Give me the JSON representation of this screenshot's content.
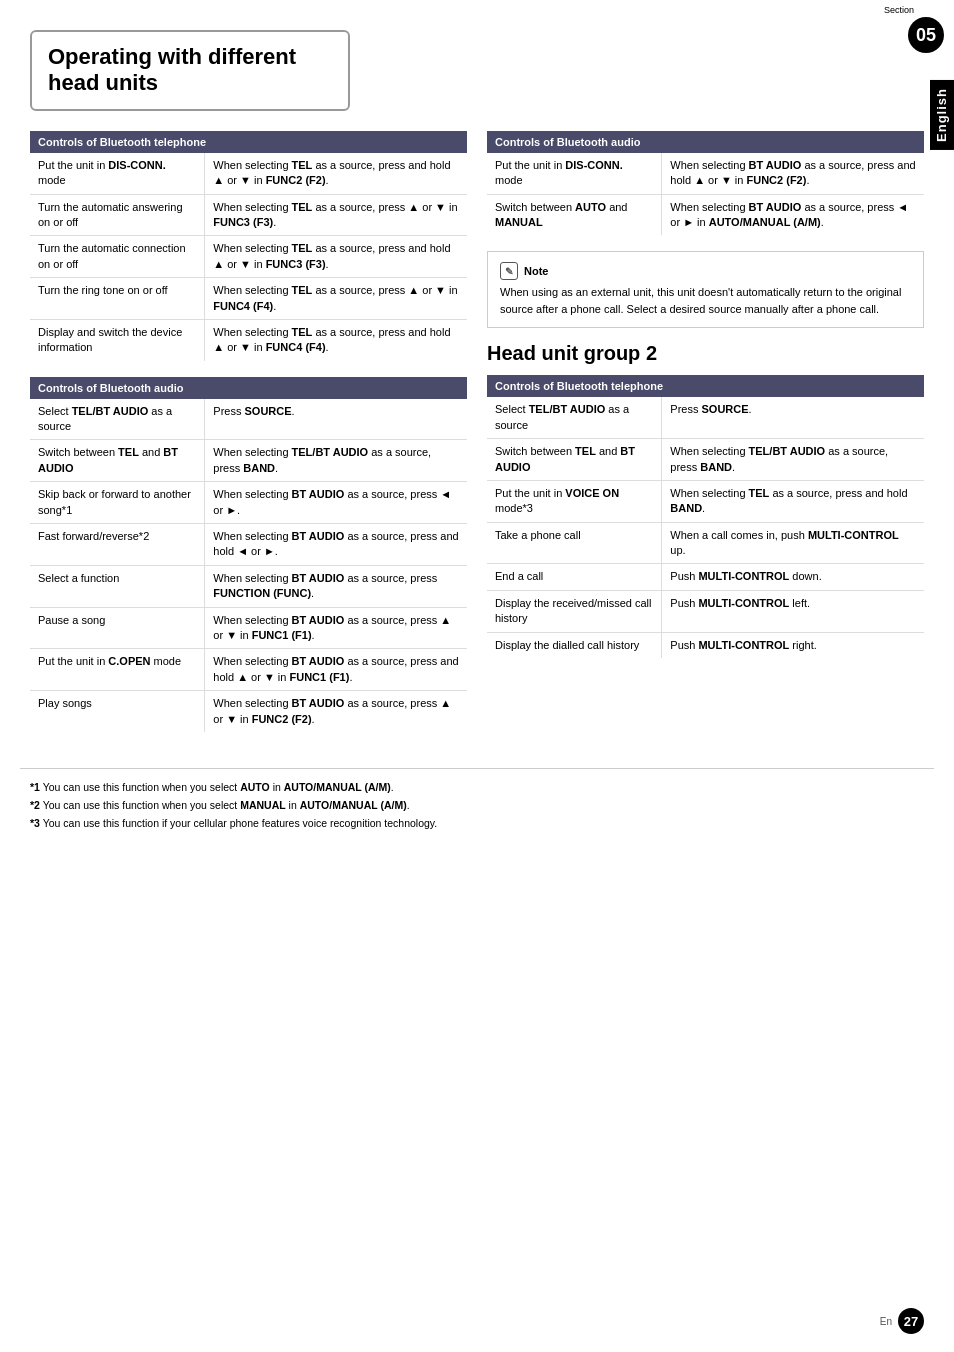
{
  "page": {
    "title": "Operating with different head units",
    "section_label": "Section",
    "section_number": "05",
    "language_label": "English",
    "page_en": "En",
    "page_number": "27"
  },
  "left_col": {
    "bt_telephone_table": {
      "header": "Controls of Bluetooth telephone",
      "rows": [
        {
          "action": "Put the unit in DIS-CONN. mode",
          "description": "When selecting TEL as a source, press and hold ▲ or ▼ in FUNC2 (F2)."
        },
        {
          "action": "Turn the automatic answering on or off",
          "description": "When selecting TEL as a source, press ▲ or ▼ in FUNC3 (F3)."
        },
        {
          "action": "Turn the automatic connection on or off",
          "description": "When selecting TEL as a source, press and hold ▲ or ▼ in FUNC3 (F3)."
        },
        {
          "action": "Turn the ring tone on or off",
          "description": "When selecting TEL as a source, press ▲ or ▼ in FUNC4 (F4)."
        },
        {
          "action": "Display and switch the device information",
          "description": "When selecting TEL as a source, press and hold ▲ or ▼ in FUNC4 (F4)."
        }
      ]
    },
    "bt_audio_table": {
      "header": "Controls of Bluetooth audio",
      "rows": [
        {
          "action": "Select TEL/BT AUDIO as a source",
          "description": "Press SOURCE."
        },
        {
          "action": "Switch between TEL and BT AUDIO",
          "description": "When selecting TEL/BT AUDIO as a source, press BAND."
        },
        {
          "action": "Skip back or forward to another song*1",
          "description": "When selecting BT AUDIO as a source, press ◄ or ►."
        },
        {
          "action": "Fast forward/reverse*2",
          "description": "When selecting BT AUDIO as a source, press and hold ◄ or ►."
        },
        {
          "action": "Select a function",
          "description": "When selecting BT AUDIO as a source, press FUNCTION (FUNC)."
        },
        {
          "action": "Pause a song",
          "description": "When selecting BT AUDIO as a source, press ▲ or ▼ in FUNC1 (F1)."
        },
        {
          "action": "Put the unit in C.OPEN mode",
          "description": "When selecting BT AUDIO as a source, press and hold ▲ or ▼ in FUNC1 (F1)."
        },
        {
          "action": "Play songs",
          "description": "When selecting BT AUDIO as a source, press ▲ or ▼ in FUNC2 (F2)."
        }
      ]
    }
  },
  "right_col": {
    "bt_audio_table_right": {
      "header": "Controls of Bluetooth audio",
      "rows": [
        {
          "action": "Put the unit in DIS-CONN. mode",
          "description": "When selecting BT AUDIO as a source, press and hold ▲ or ▼ in FUNC2 (F2)."
        },
        {
          "action": "Switch between AUTO and MANUAL",
          "description": "When selecting BT AUDIO as a source, press ◄ or ► in AUTO/MANUAL (A/M)."
        }
      ]
    },
    "note": {
      "icon": "✎",
      "title": "Note",
      "text": "When using as an external unit, this unit doesn't automatically return to the original source after a phone call. Select a desired source manually after a phone call."
    },
    "head_unit_group2_title": "Head unit group 2",
    "bt_telephone_table2": {
      "header": "Controls of Bluetooth telephone",
      "rows": [
        {
          "action": "Select TEL/BT AUDIO as a source",
          "description": "Press SOURCE."
        },
        {
          "action": "Switch between TEL and BT AUDIO",
          "description": "When selecting TEL/BT AUDIO as a source, press BAND."
        },
        {
          "action": "Put the unit in VOICE ON mode*3",
          "description": "When selecting TEL as a source, press and hold BAND."
        },
        {
          "action": "Take a phone call",
          "description": "When a call comes in, push MULTI-CONTROL up."
        },
        {
          "action": "End a call",
          "description": "Push MULTI-CONTROL down."
        },
        {
          "action": "Display the received/missed call history",
          "description": "Push MULTI-CONTROL left."
        },
        {
          "action": "Display the dialled call history",
          "description": "Push MULTI-CONTROL right."
        }
      ]
    }
  },
  "footnotes": [
    {
      "marker": "*1",
      "text": "You can use this function when you select AUTO in AUTO/MANUAL (A/M)."
    },
    {
      "marker": "*2",
      "text": "You can use this function when you select MANUAL in AUTO/MANUAL (A/M)."
    },
    {
      "marker": "*3",
      "text": "You can use this function if your cellular phone features voice recognition technology."
    }
  ]
}
